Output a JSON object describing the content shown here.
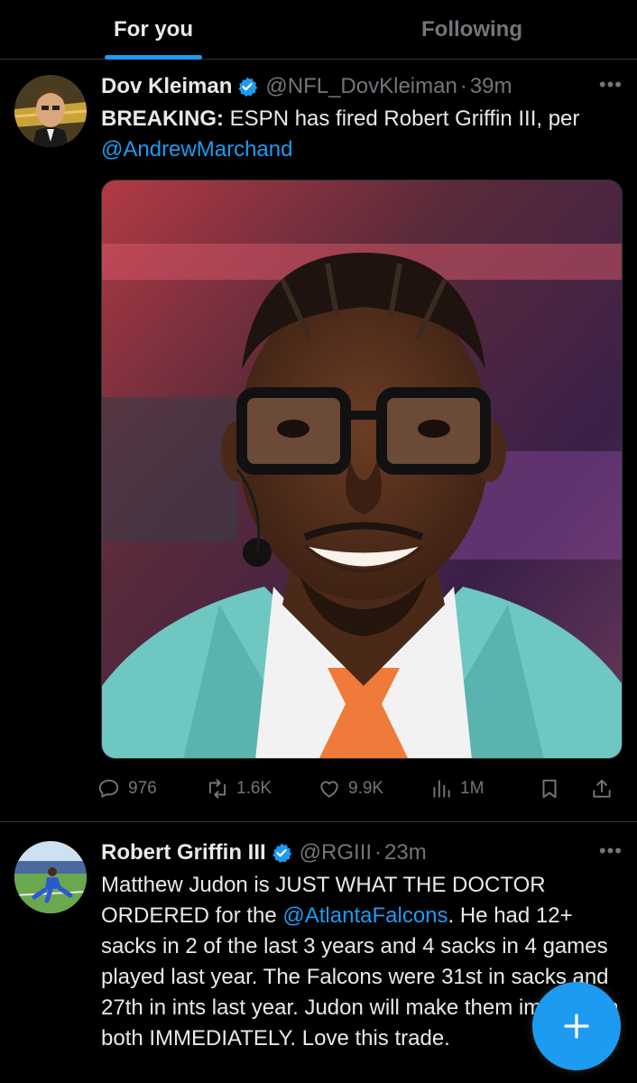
{
  "tabs": {
    "for_you": "For you",
    "following": "Following"
  },
  "tweets": [
    {
      "name": "Dov Kleiman",
      "handle": "@NFL_DovKleiman",
      "separator": "·",
      "time": "39m",
      "more": "•••",
      "text_bold": "BREAKING:",
      "text": " ESPN has fired Robert Griffin III, per ",
      "mention": "@AndrewMarchand",
      "stats": {
        "replies": "976",
        "reposts": "1.6K",
        "likes": "9.9K",
        "views": "1M"
      }
    },
    {
      "name": "Robert Griffin III",
      "handle": "@RGIII",
      "separator": "·",
      "time": "23m",
      "more": "•••",
      "text_before": "Matthew Judon is JUST WHAT THE DOCTOR ORDERED for the ",
      "mention": "@AtlantaFalcons",
      "text_after": ". He had 12+ sacks in 2 of the last 3 years and 4 sacks in 4 games played last year. The Falcons were 31st in sacks and 27th in ints last year. Judon will make them improve in both IMMEDIATELY. Love this trade."
    }
  ],
  "colors": {
    "accent": "#1d9bf0",
    "muted": "#71767b",
    "text": "#e7e9ea",
    "divider": "#2f3336"
  },
  "icons": [
    "verified-badge-icon",
    "more-icon",
    "reply-icon",
    "repost-icon",
    "like-icon",
    "views-icon",
    "bookmark-icon",
    "share-icon",
    "plus-icon"
  ]
}
